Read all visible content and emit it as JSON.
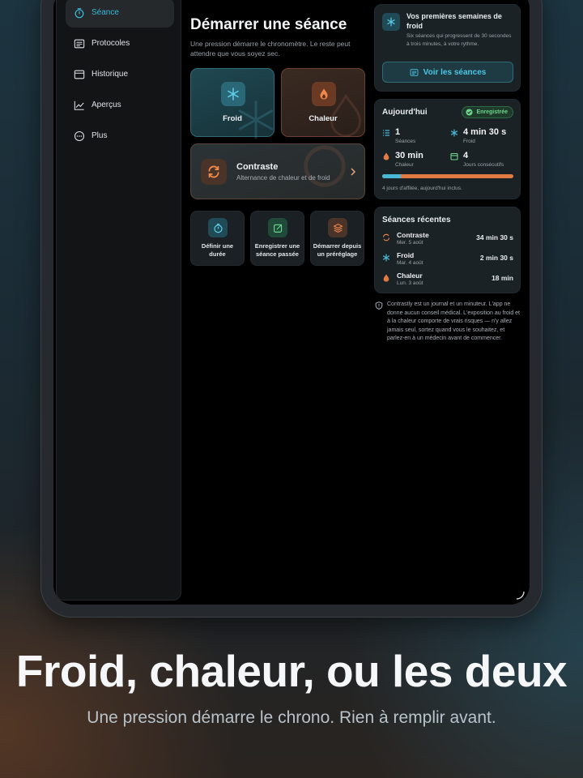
{
  "sidebar": {
    "items": [
      {
        "label": "Séance",
        "icon": "timer-icon",
        "active": true
      },
      {
        "label": "Protocoles",
        "icon": "list-icon"
      },
      {
        "label": "Historique",
        "icon": "calendar-icon"
      },
      {
        "label": "Aperçus",
        "icon": "chart-icon"
      },
      {
        "label": "Plus",
        "icon": "more-icon"
      }
    ]
  },
  "main": {
    "title": "Démarrer une séance",
    "subtitle": "Une pression démarre le chronomètre. Le reste peut attendre que vous soyez sec.",
    "tiles": {
      "cold": "Froid",
      "heat": "Chaleur",
      "contrast_title": "Contraste",
      "contrast_sub": "Alternance de chaleur et de froid"
    },
    "actions": [
      {
        "label": "Définir une durée"
      },
      {
        "label": "Enregistrer une séance passée"
      },
      {
        "label": "Démarrer depuis un préréglage"
      }
    ]
  },
  "intro": {
    "title": "Vos premières semaines de froid",
    "text": "Six séances qui progressent de 30 secondes à trois minutes, à votre rythme.",
    "button": "Voir les séances"
  },
  "today": {
    "title": "Aujourd'hui",
    "badge": "Enregistrée",
    "stats": [
      {
        "value": "1",
        "label": "Séances"
      },
      {
        "value": "4 min 30 s",
        "label": "Froid"
      },
      {
        "value": "30 min",
        "label": "Chaleur"
      },
      {
        "value": "4",
        "label": "Jours consécutifs"
      }
    ],
    "progress_cold_fraction": 0.14,
    "streak_note": "4 jours d'affilée, aujourd'hui inclus."
  },
  "recent": {
    "title": "Séances récentes",
    "rows": [
      {
        "name": "Contraste",
        "date": "Mer. 5 août",
        "value": "34 min 30 s",
        "icon": "contrast-icon"
      },
      {
        "name": "Froid",
        "date": "Mar. 4 août",
        "value": "2 min 30 s",
        "icon": "snowflake-icon"
      },
      {
        "name": "Chaleur",
        "date": "Lun. 3 août",
        "value": "18 min",
        "icon": "flame-icon"
      }
    ]
  },
  "disclaimer": "Contrastly est un journal et un minuteur. L'app ne donne aucun conseil médical. L'exposition au froid et à la chaleur comporte de vrais risques — n'y allez jamais seul, sortez quand vous le souhaitez, et parlez-en à un médecin avant de commencer.",
  "marketing": {
    "headline": "Froid, chaleur, ou les deux",
    "subline": "Une pression démarre le chrono. Rien à remplir avant."
  },
  "colors": {
    "cold": "#49b8d6",
    "heat": "#e07b43",
    "success": "#6fd58d"
  }
}
